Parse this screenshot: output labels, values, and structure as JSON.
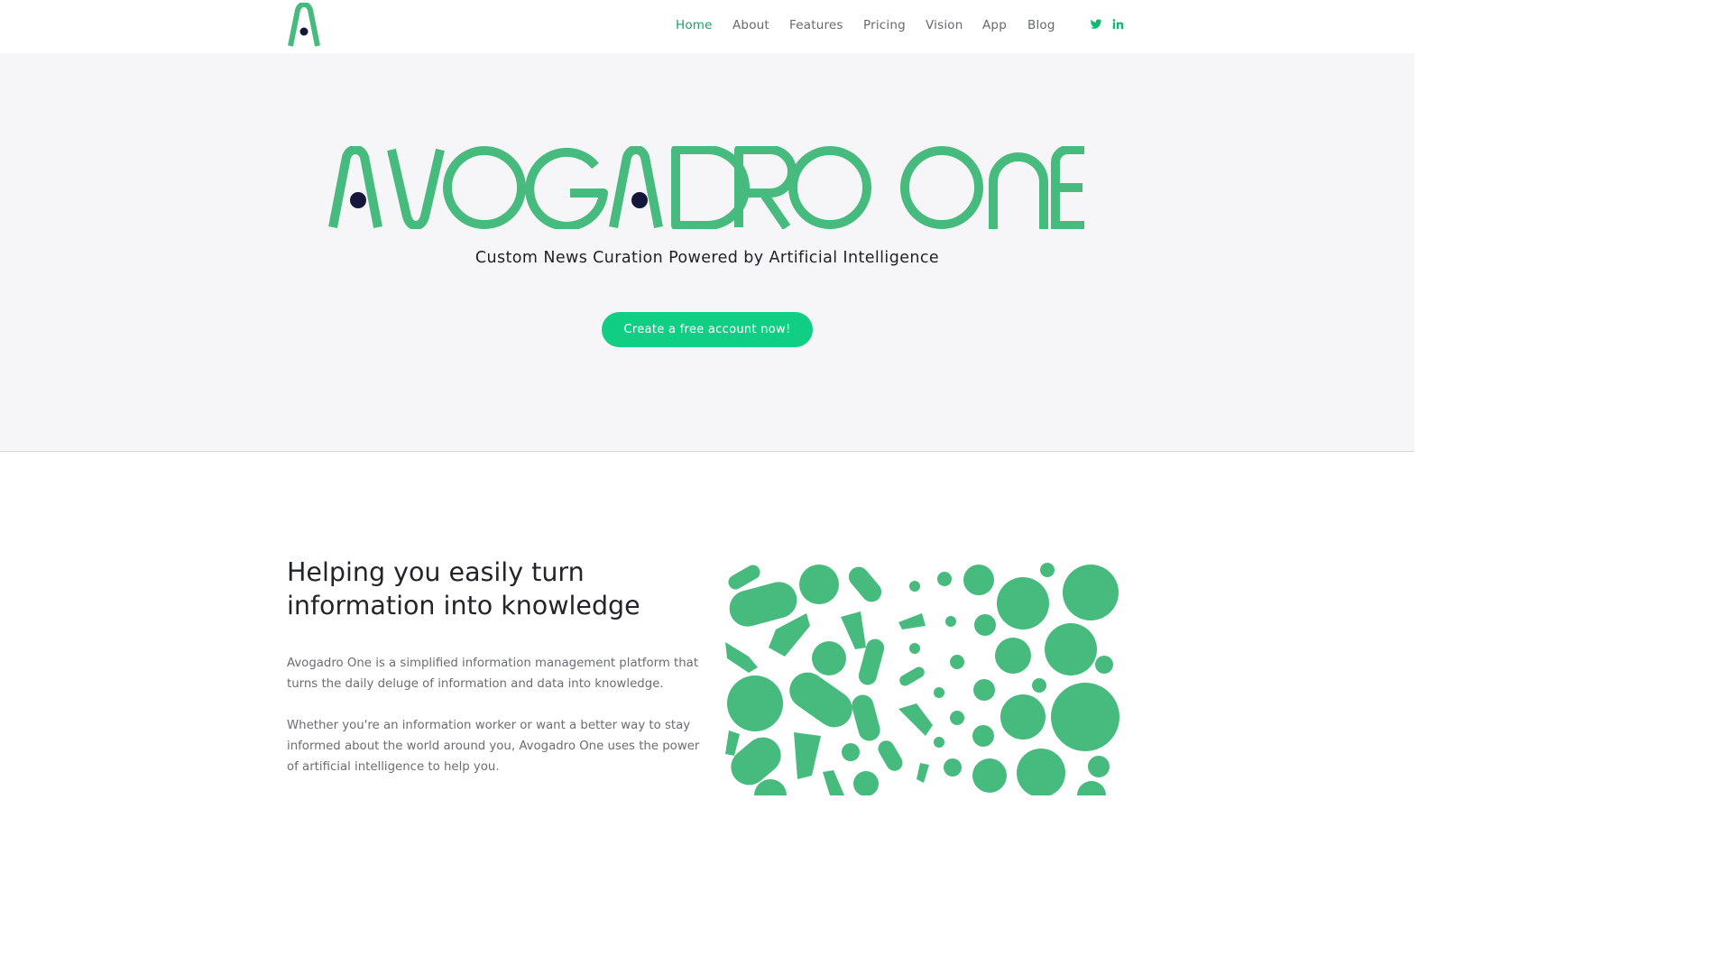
{
  "colors": {
    "brand_green": "#47bb7d",
    "accent_green": "#10cf85",
    "active_link": "#1e9e6a",
    "navy_dot": "#15173a",
    "hero_bg": "#f6f6f9"
  },
  "nav": {
    "logo_icon": "avogadro-a-logo",
    "links": [
      {
        "label": "Home",
        "active": true
      },
      {
        "label": "About"
      },
      {
        "label": "Features"
      },
      {
        "label": "Pricing"
      },
      {
        "label": "Vision"
      },
      {
        "label": "App"
      },
      {
        "label": "Blog"
      }
    ],
    "social": [
      "twitter-icon",
      "linkedin-icon"
    ]
  },
  "hero": {
    "wordmark": "AVOGADRO ONE",
    "subtitle": "Custom News Curation Powered by Artificial Intelligence",
    "cta_label": "Create a free account now!"
  },
  "section": {
    "title": "Helping you easily turn information into knowledge",
    "paragraphs": [
      "Avogadro One is a simplified information management platform that turns the daily deluge of information and data into knowledge.",
      "Whether you're an information worker or want a better way to stay informed about the world around you, Avogadro One uses the power of artificial intelligence to help you."
    ],
    "illustration": "molecule-shapes-illustration"
  }
}
